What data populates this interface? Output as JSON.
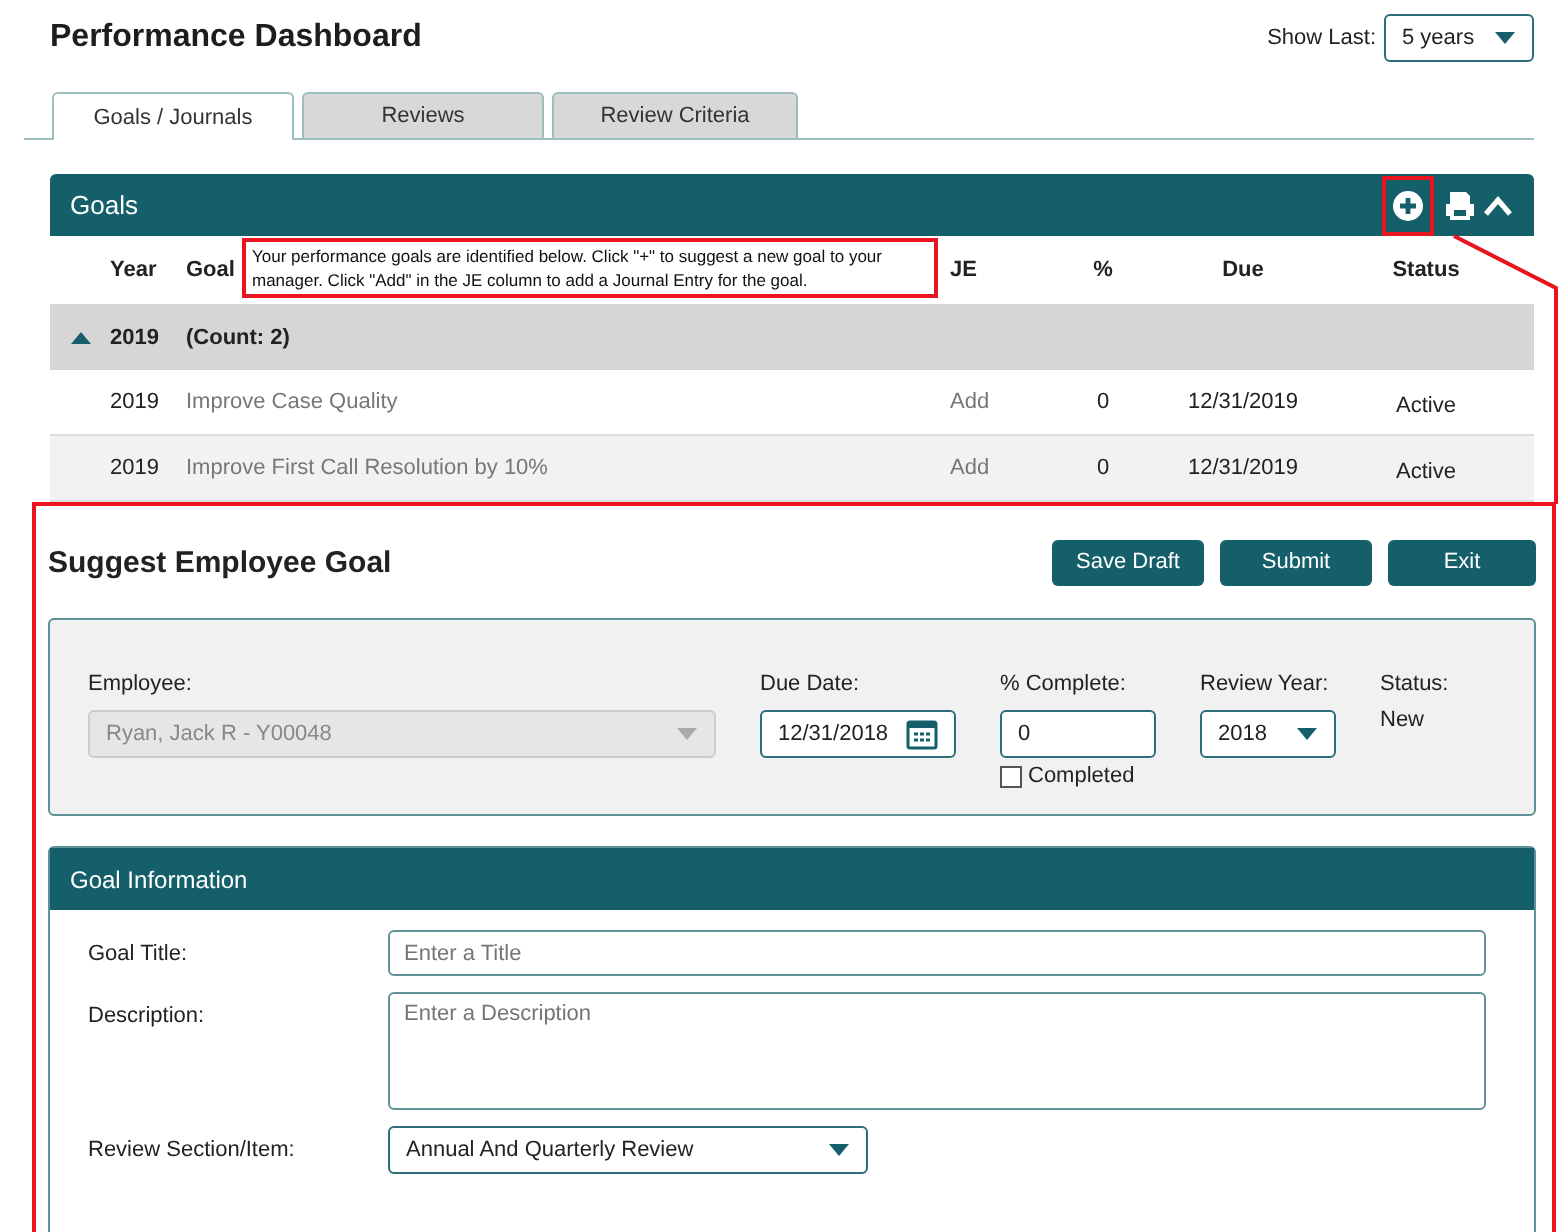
{
  "page": {
    "title": "Performance Dashboard",
    "show_last": {
      "label": "Show Last:",
      "value": "5 years"
    }
  },
  "tabs": [
    {
      "label": "Goals / Journals",
      "selected": true
    },
    {
      "label": "Reviews",
      "selected": false
    },
    {
      "label": "Review Criteria",
      "selected": false
    }
  ],
  "goals_panel": {
    "title": "Goals",
    "tooltip": "Your performance goals are identified below.  Click \"+\" to suggest a new goal to your manager.  Click \"Add\" in the JE column to add a Journal Entry for the goal.",
    "columns": [
      "Year",
      "Goal",
      "JE",
      "%",
      "Due",
      "Status"
    ],
    "group": {
      "year": "2019",
      "count": "(Count: 2)",
      "expanded": true
    },
    "rows": [
      {
        "year": "2019",
        "goal": "Improve Case Quality",
        "je": "Add",
        "percent": "0",
        "due": "12/31/2019",
        "status": "Active"
      },
      {
        "year": "2019",
        "goal": "Improve First Call Resolution by 10%",
        "je": "Add",
        "percent": "0",
        "due": "12/31/2019",
        "status": "Active"
      }
    ]
  },
  "suggest_goal": {
    "title": "Suggest Employee Goal",
    "buttons": [
      "Save Draft",
      "Submit",
      "Exit"
    ],
    "employee": {
      "label": "Employee:",
      "value": "Ryan, Jack R - Y00048",
      "disabled": true
    },
    "due_date": {
      "label": "Due Date:",
      "value": "12/31/2018"
    },
    "percent_complete": {
      "label": "% Complete:",
      "value": "0"
    },
    "completed": {
      "label": "Completed",
      "checked": false
    },
    "review_year": {
      "label": "Review Year:",
      "value": "2018"
    },
    "status": {
      "label": "Status:",
      "value": "New"
    }
  },
  "goal_information": {
    "title": "Goal Information",
    "fields": [
      {
        "kind": "input",
        "label": "Goal Title:",
        "placeholder": "Enter a Title"
      },
      {
        "kind": "textarea",
        "label": "Description:",
        "placeholder": "Enter a Description"
      },
      {
        "kind": "select",
        "label": "Review Section/Item:",
        "value": "Annual And Quarterly Review"
      }
    ]
  }
}
